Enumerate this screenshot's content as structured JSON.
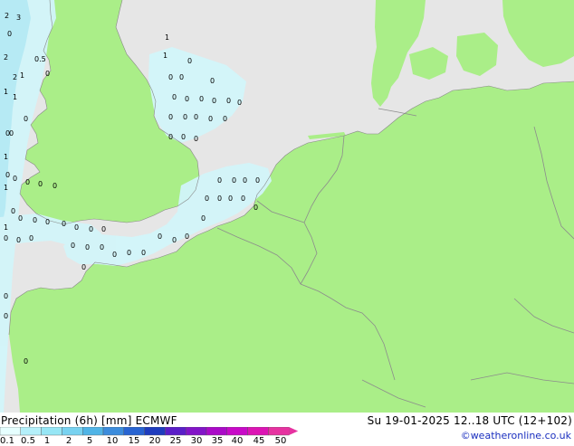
{
  "legend": {
    "title": "Precipitation (6h) [mm] ECMWF",
    "datetime": "Su 19-01-2025 12..18 UTC (12+102)",
    "credit": "©weatheronline.co.uk",
    "labels": [
      "0.1",
      "0.5",
      "1",
      "2",
      "5",
      "10",
      "15",
      "20",
      "25",
      "30",
      "35",
      "40",
      "45",
      "50"
    ],
    "colors": [
      "#e6ffff",
      "#b4f0fa",
      "#96e6f5",
      "#78d2f0",
      "#50b4e6",
      "#3c8cdc",
      "#2864d2",
      "#1e3cbe",
      "#5a1ec8",
      "#8214c8",
      "#aa0ac8",
      "#c80ac8",
      "#dc14b4",
      "#e632a0"
    ]
  },
  "map": {
    "colors": {
      "sea": "#e6e6e6",
      "land": "#aaee88",
      "precip": "#d2f5fa",
      "precip_dark": "#b4ebf5",
      "border": "#8c8c8c"
    },
    "values": [
      "2",
      "3",
      "0",
      "2",
      "0.5",
      "1",
      "0",
      "1",
      "2",
      "1",
      "0",
      "0",
      "1",
      "1",
      "0",
      "0",
      "0",
      "0",
      "0",
      "0",
      "0",
      "0",
      "0",
      "0",
      "0",
      "0",
      "0",
      "0",
      "0",
      "0",
      "0",
      "0",
      "0",
      "0",
      "0",
      "0",
      "0",
      "0",
      "0",
      "0",
      "0",
      "0",
      "0",
      "0",
      "0",
      "0",
      "0",
      "0",
      "0",
      "0",
      "0",
      "0",
      "0",
      "0",
      "0",
      "0",
      "0",
      "0",
      "0",
      "0",
      "0",
      "0",
      "0",
      "0",
      "0",
      "0",
      "0",
      "0",
      "0",
      "0",
      "1",
      "0",
      "1",
      "0",
      "1",
      "0",
      "0",
      "0"
    ]
  }
}
